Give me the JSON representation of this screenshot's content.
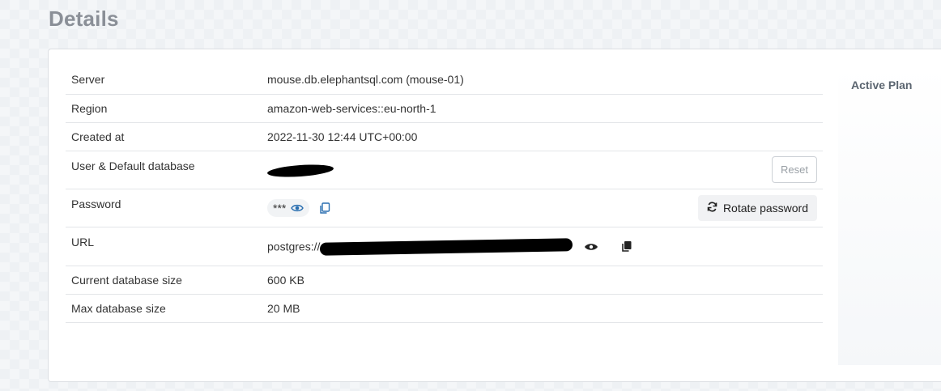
{
  "page": {
    "title": "Details"
  },
  "details": {
    "server": {
      "label": "Server",
      "value": "mouse.db.elephantsql.com (mouse-01)"
    },
    "region": {
      "label": "Region",
      "value": "amazon-web-services::eu-north-1"
    },
    "created": {
      "label": "Created at",
      "value": "2022-11-30 12:44 UTC+00:00"
    },
    "user": {
      "label": "User & Default database",
      "reset_label": "Reset"
    },
    "password": {
      "label": "Password",
      "value": "***",
      "rotate_label": "Rotate password"
    },
    "url": {
      "label": "URL",
      "value_prefix": "postgres://"
    },
    "current_size": {
      "label": "Current database size",
      "value": "600 KB"
    },
    "max_size": {
      "label": "Max database size",
      "value": "20 MB"
    }
  },
  "side": {
    "title": "Active Plan"
  },
  "icons": {
    "eye": "eye-icon",
    "copy": "copy-icon",
    "refresh": "refresh-icon"
  },
  "colors": {
    "accent": "#2a6fb0",
    "title": "#8a8f97"
  }
}
